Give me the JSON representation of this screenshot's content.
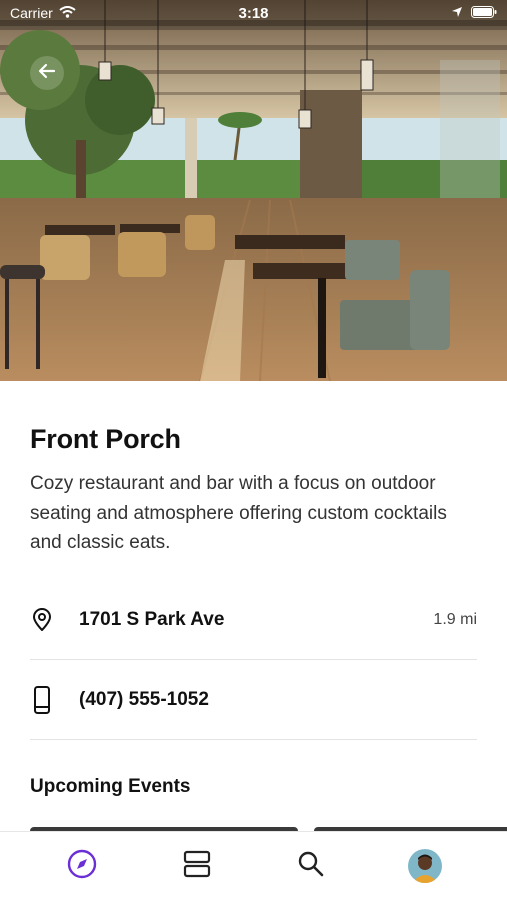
{
  "status_bar": {
    "carrier": "Carrier",
    "time": "3:18"
  },
  "hero": {
    "image": "restaurant-patio-photo"
  },
  "venue": {
    "name": "Front Porch",
    "description": "Cozy restaurant and bar with a focus on outdoor seating and atmosphere offering custom cocktails and classic eats.",
    "address": "1701 S Park Ave",
    "distance": "1.9 mi",
    "phone": "(407) 555-1052"
  },
  "sections": {
    "upcoming_events": "Upcoming Events"
  },
  "tab_bar": {
    "items": [
      {
        "icon": "compass-icon",
        "active": true
      },
      {
        "icon": "list-icon",
        "active": false
      },
      {
        "icon": "search-icon",
        "active": false
      },
      {
        "icon": "avatar",
        "active": false
      }
    ]
  },
  "colors": {
    "accent": "#6b2fd6",
    "text": "#111111",
    "divider": "#e3e3e3"
  }
}
